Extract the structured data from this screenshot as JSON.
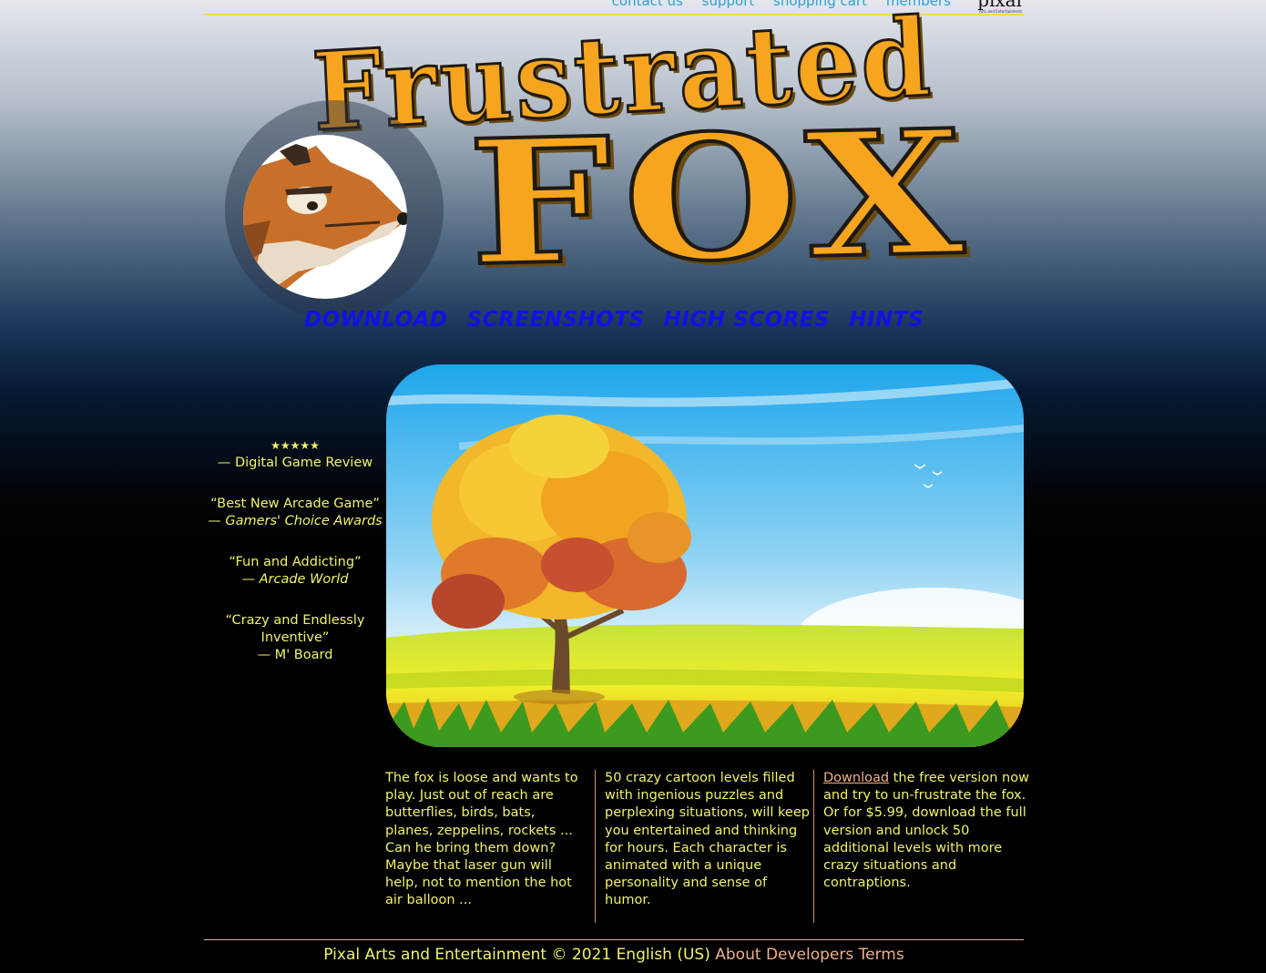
{
  "topnav": {
    "links": [
      "contact us",
      "support",
      "shopping cart",
      "members"
    ],
    "brand": "pixal",
    "brand_tagline": "Arts and Entertainment"
  },
  "logo": {
    "line1": "Frustrated",
    "line2": "FOX",
    "emblem_icon": "fox-head-icon"
  },
  "mainnav": [
    "DOWNLOAD",
    "SCREENSHOTS",
    "HIGH SCORES",
    "HINTS"
  ],
  "hero": {
    "image_icon": "autumn-tree-landscape"
  },
  "quotes": [
    {
      "text": "★★★★★",
      "source": "— Digital Game Review"
    },
    {
      "text": "“Best New Arcade Game”",
      "source_prefix": "— ",
      "source": "Gamers' Choice Awards"
    },
    {
      "text": "“Fun and Addicting”",
      "source_prefix": "— ",
      "source": "Arcade World"
    },
    {
      "text": "“Crazy and Endlessly Inventive”",
      "source": "— M' Board"
    }
  ],
  "columns": {
    "col1": "The fox is loose and wants to play. Just out of reach are butterflies, birds, bats, planes, zeppelins, rockets ... Can he bring them down? Maybe that laser gun will help, not to mention the hot air balloon ...",
    "col2": "50 crazy cartoon levels filled with ingenious puzzles and perplexing situations, will keep you entertained and thinking for hours. Each character is animated with a unique personality and sense of humor.",
    "col3_link": "Download",
    "col3_text": " the free version now and try to un-frustrate the fox. Or for $5.99, download the full version and unlock 50 additional levels with more crazy situations and contraptions."
  },
  "footer": {
    "text": "Pixal Arts and Entertainment © 2021 English (US)",
    "links": [
      "About",
      "Developers",
      "Terms"
    ]
  },
  "colors": {
    "accent_yellow": "#f2f26a",
    "logo_orange": "#f7a51f",
    "nav_blue": "#1111e6",
    "link_salmon": "#f0b088",
    "topnav_blue": "#2aa0d8"
  }
}
